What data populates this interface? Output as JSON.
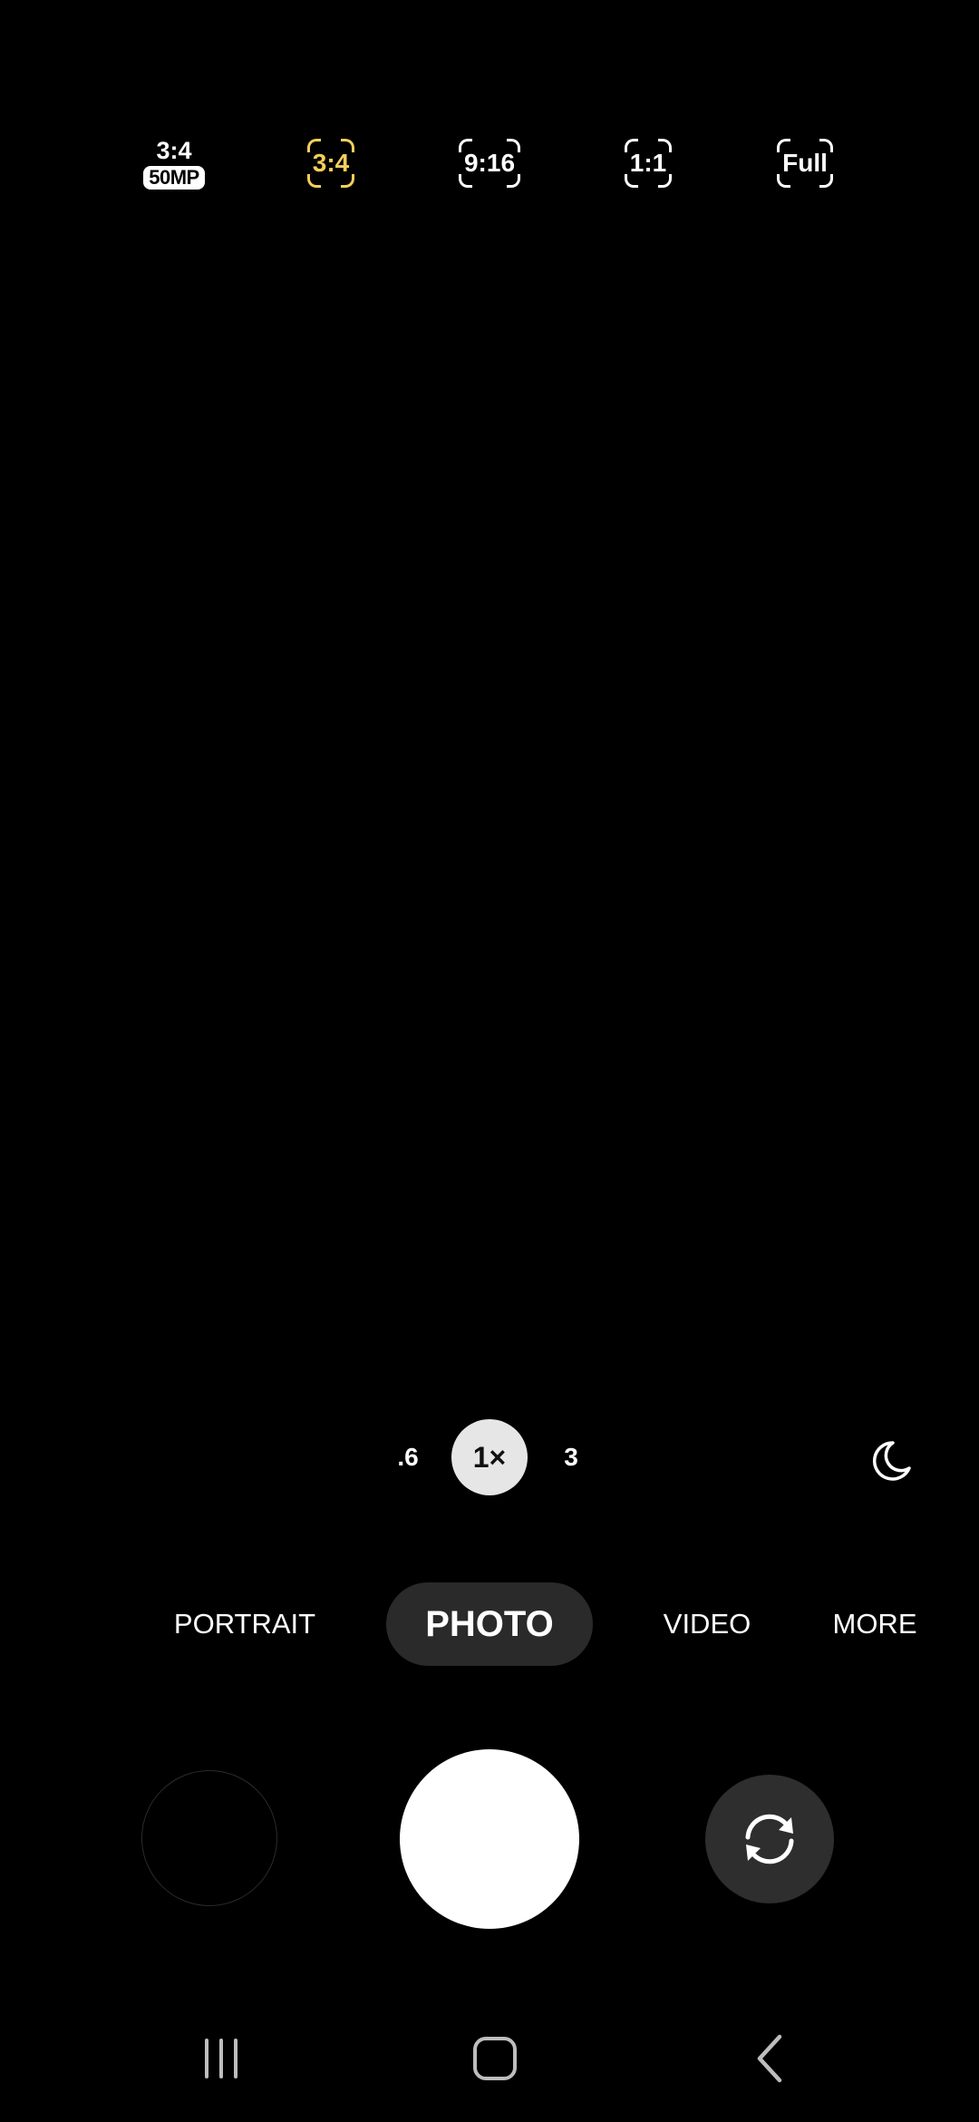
{
  "aspect_ratios": {
    "r50mp_ratio": "3:4",
    "r50mp_badge": "50MP",
    "r34": "3:4",
    "r916": "9:16",
    "r11": "1:1",
    "rfull": "Full",
    "selected": "3:4",
    "selected_color": "#f5cf5b"
  },
  "zoom": {
    "wide": ".6",
    "main": "1×",
    "tele": "3"
  },
  "night_mode_icon": "moon-icon",
  "modes": {
    "portrait": "PORTRAIT",
    "photo": "PHOTO",
    "video": "VIDEO",
    "more": "MORE",
    "selected": "PHOTO"
  },
  "controls": {
    "gallery_icon": "gallery-thumbnail",
    "shutter_icon": "shutter-button",
    "switch_icon": "switch-camera-icon"
  },
  "navbar": {
    "recent_icon": "recent-apps-icon",
    "home_icon": "home-icon",
    "back_icon": "back-icon"
  }
}
